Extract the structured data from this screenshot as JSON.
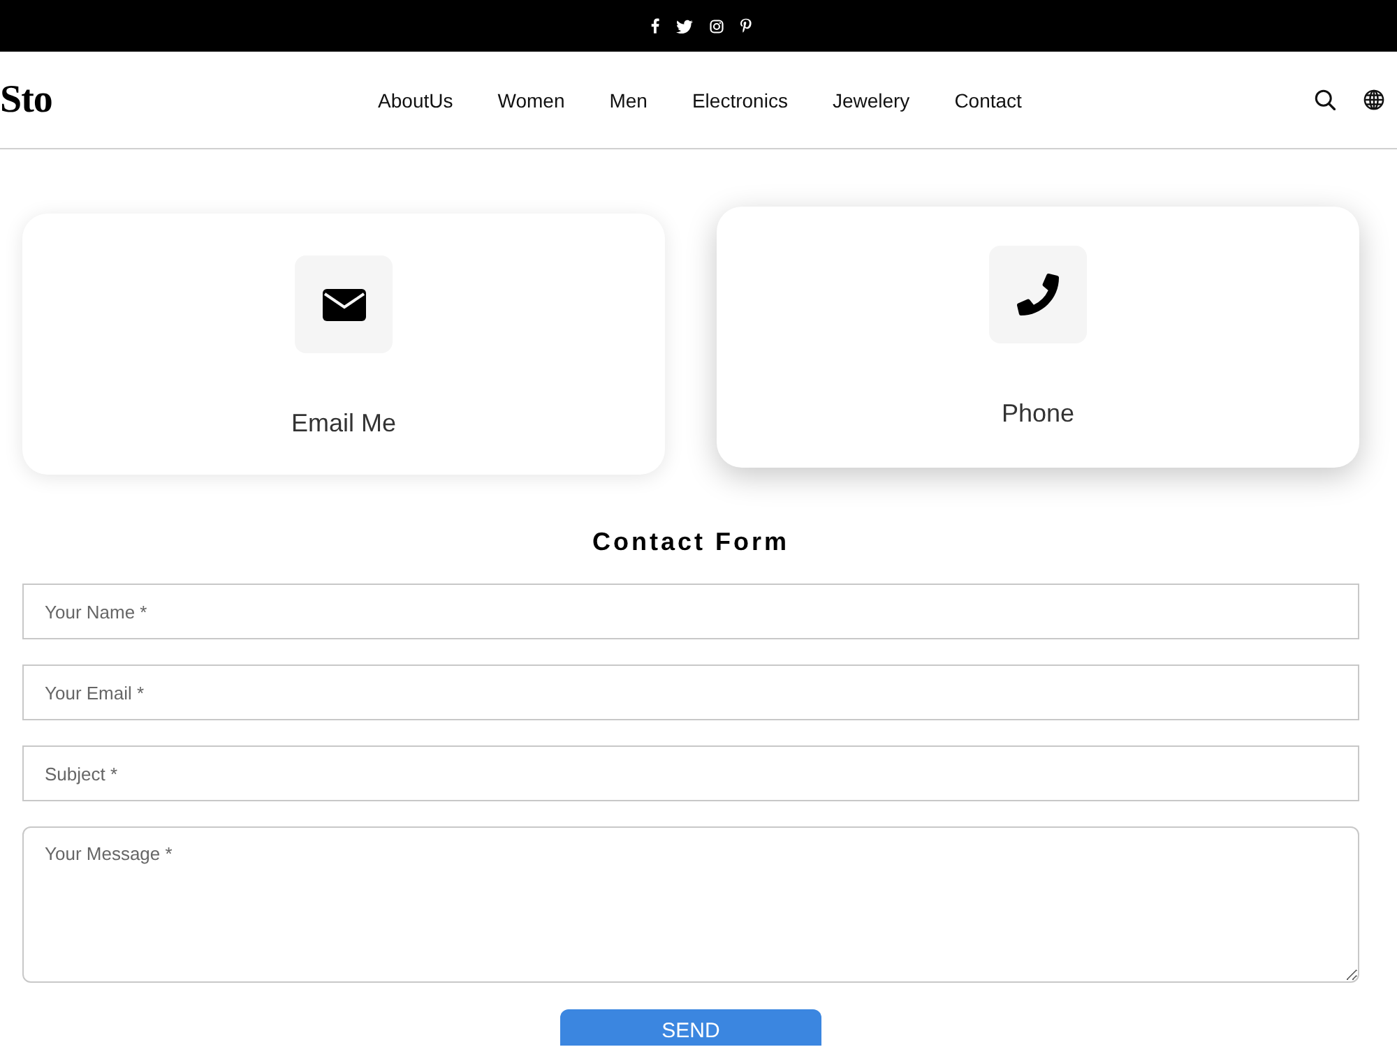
{
  "header": {
    "logo": "Sto",
    "nav": [
      "AboutUs",
      "Women",
      "Men",
      "Electronics",
      "Jewelery",
      "Contact"
    ]
  },
  "cards": [
    {
      "kind": "email",
      "label": "Email Me",
      "hovered": false
    },
    {
      "kind": "phone",
      "label": "Phone",
      "hovered": true
    }
  ],
  "form": {
    "title": "Contact Form",
    "fields": [
      {
        "kind": "input",
        "placeholder": "Your Name *"
      },
      {
        "kind": "input",
        "placeholder": "Your Email *"
      },
      {
        "kind": "input",
        "placeholder": "Subject *"
      },
      {
        "kind": "textarea",
        "placeholder": "Your Message *"
      }
    ],
    "submit": "SEND"
  }
}
